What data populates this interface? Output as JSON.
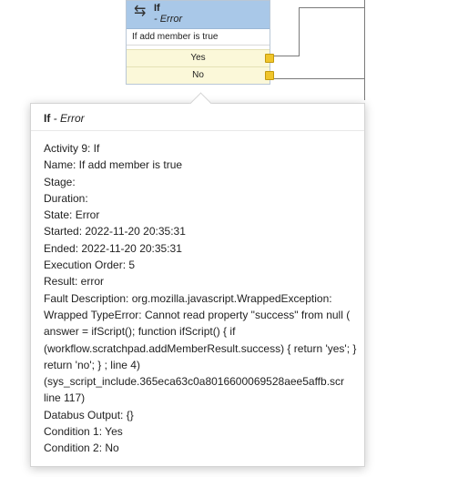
{
  "node": {
    "title": "If",
    "subtitle": "- Error",
    "condition": "If add member is true",
    "outputs": [
      "Yes",
      "No"
    ],
    "icon": "branch-icon",
    "header_color": "#a9c8e8",
    "output_color": "#fbf8d9",
    "output_dot_color": "#f0c52b"
  },
  "tooltip": {
    "title_bold": "If",
    "title_rest": " - Error",
    "lines": [
      "Activity 9: If",
      "Name: If add member is true",
      "Stage:",
      "Duration:",
      "State: Error",
      "Started: 2022-11-20 20:35:31",
      "Ended: 2022-11-20 20:35:31",
      "Execution Order: 5",
      "Result: error"
    ],
    "fault": "Fault Description: org.mozilla.javascript.WrappedException: Wrapped TypeError: Cannot read property \"success\" from null ( answer = ifScript(); function ifScript() { if (workflow.scratchpad.addMemberResult.success) { return 'yes'; } return 'no'; } ; line 4)",
    "fault_script": "(sys_script_include.365eca63c0a8016600069528aee5affb.scr",
    "fault_line": "line 117)",
    "tail_lines": [
      "Databus Output: {}",
      "Condition 1: Yes",
      "Condition 2: No"
    ]
  }
}
